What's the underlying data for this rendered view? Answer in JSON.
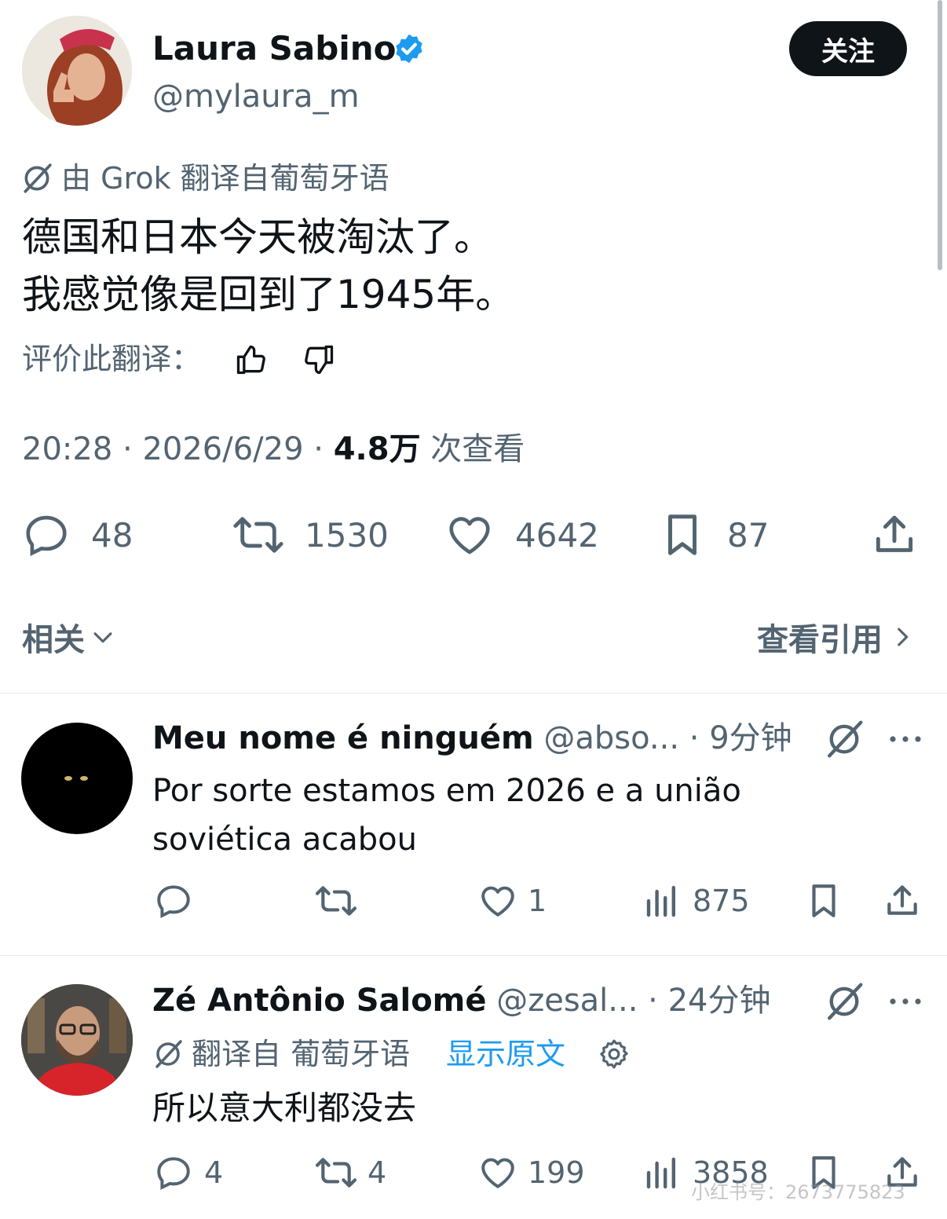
{
  "main_tweet": {
    "author": {
      "name": "Laura Sabino",
      "handle": "@mylaura_m"
    },
    "follow_label": "关注",
    "translation_note": "由 Grok 翻译自葡萄牙语",
    "text_lines": [
      "德国和日本今天被淘汰了。",
      "我感觉像是回到了1945年。"
    ],
    "rate_label": "评价此翻译：",
    "meta": {
      "time": "20:28",
      "date": "2026/6/29",
      "views_count": "4.8万",
      "views_label": "次查看"
    },
    "stats": {
      "replies": "48",
      "retweets": "1530",
      "likes": "4642",
      "bookmarks": "87"
    },
    "related_label": "相关",
    "view_quotes_label": "查看引用"
  },
  "replies": [
    {
      "name": "Meu nome é ninguém",
      "handle": "@abso...",
      "time": "9分钟",
      "text_lines": [
        "Por sorte estamos em 2026 e a união",
        "soviética acabou"
      ],
      "stats": {
        "replies": "",
        "retweets": "",
        "likes": "1",
        "views": "875"
      }
    },
    {
      "name": "Zé Antônio Salomé",
      "handle": "@zesal...",
      "time": "24分钟",
      "translation_prefix": "翻译自 葡萄牙语",
      "show_original": "显示原文",
      "text_lines": [
        "所以意大利都没去"
      ],
      "stats": {
        "replies": "4",
        "retweets": "4",
        "likes": "199",
        "views": "3858"
      }
    }
  ],
  "watermark": "小红书号：2673775823",
  "colors": {
    "text": "#0f1419",
    "muted": "#536471",
    "link": "#1d9bf0",
    "verified": "#1d9bf0",
    "divider": "#e6e8eb"
  }
}
